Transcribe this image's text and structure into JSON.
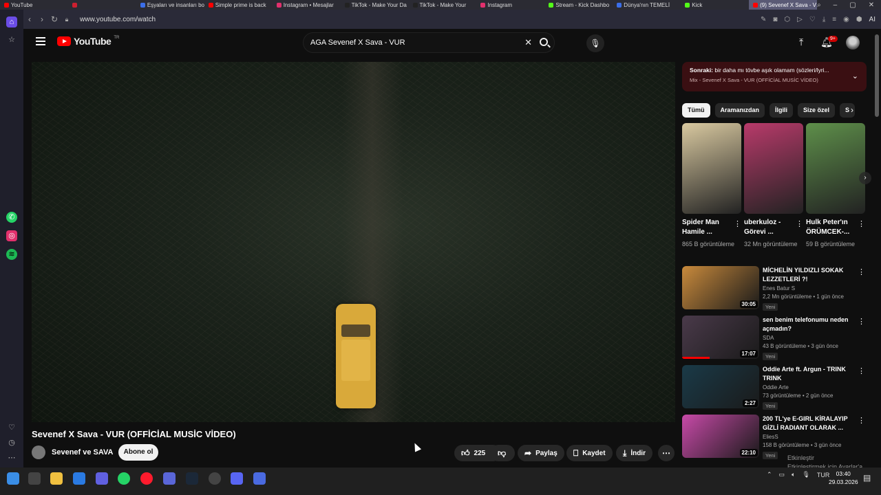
{
  "browser": {
    "tabs": [
      {
        "label": "YouTube",
        "color": "#ff0000"
      },
      {
        "label": "",
        "color": "#cc1f2f"
      },
      {
        "label": "Eşyaları ve insanları bo",
        "color": "#3b6ee8"
      },
      {
        "label": "Simple prime is back",
        "color": "#ff0000"
      },
      {
        "label": "Instagram • Mesajlar",
        "color": "#e1306c"
      },
      {
        "label": "TikTok - Make Your Da",
        "color": "#222222"
      },
      {
        "label": "TikTok - Make Your",
        "color": "#222222"
      },
      {
        "label": "Instagram",
        "color": "#e1306c"
      },
      {
        "label": "Stream - Kick Dashbo",
        "color": "#53fc18"
      },
      {
        "label": "Dünya'nın TEMELİ",
        "color": "#3b6ee8"
      },
      {
        "label": "Kick",
        "color": "#53fc18"
      },
      {
        "label": "(9) Sevenef X Sava - V",
        "color": "#ff0000"
      }
    ],
    "url": "www.youtube.com/watch",
    "ai_label": "AI"
  },
  "header": {
    "logo_text": "YouTube",
    "region": "TR",
    "search_value": "AGA Sevenef X Sava - VUR",
    "notif_badge": "9+"
  },
  "video": {
    "title": "Sevenef X Sava - VUR (OFFİCİAL MUSİC VİDEO)",
    "channel": "Sevenef ve SAVA",
    "subscribe_label": "Abone ol",
    "likes": "225",
    "share_label": "Paylaş",
    "save_label": "Kaydet",
    "download_label": "İndir"
  },
  "upnext": {
    "prefix": "Sonraki:",
    "title": " bir daha mı tövbe aşık olamam (sözleri/lyri...",
    "mix": "Mix - Sevenef X Sava - VUR (OFFİCİAL MUSİC VİDEO)"
  },
  "chips": [
    "Tümü",
    "Aramanızdan",
    "İlgili",
    "Size özel",
    "S"
  ],
  "shorts": [
    {
      "title": "Spider Man Hamile ...",
      "views": "865 B görüntüleme",
      "color": "#d9c9a0"
    },
    {
      "title": "uberkuloz - Görevi ...",
      "views": "32 Mn görüntüleme",
      "color": "#b83a6a"
    },
    {
      "title": "Hulk Peter'ın ÖRÜMCEK-...",
      "views": "59 B görüntüleme",
      "color": "#5e8f4a"
    }
  ],
  "videos": [
    {
      "title": "MİCHELİN YILDIZLI SOKAK LEZZETLERİ ?!",
      "channel": "Enes Batur S",
      "stats": "2,2 Mn görüntüleme • 1 gün önce",
      "duration": "30:05",
      "badge": "Yeni",
      "color": "#c98a3c"
    },
    {
      "title": "sen benim telefonumu neden açmadın?",
      "channel": "SDA",
      "stats": "43 B görüntüleme • 3 gün önce",
      "duration": "17:07",
      "badge": "Yeni",
      "color": "#4a3a4a"
    },
    {
      "title": "Oddie Arte ft. Argun - TRINK TRINK",
      "channel": "Oddie Arte",
      "stats": "73 görüntüleme • 2 gün önce",
      "duration": "2:27",
      "badge": "Yeni",
      "color": "#1a3a48"
    },
    {
      "title": "200 TL'ye E-GIRL KİRALAYIP GİZLİ RADIANT OLARAK ...",
      "channel": "EliesS",
      "stats": "158 B görüntüleme • 3 gün önce",
      "duration": "22:10",
      "badge": "Yeni",
      "color": "#c84aa8"
    }
  ],
  "windows_watermark": {
    "line1": "Etkinleştir",
    "line2": "Etkinleştirmek için Ayarlar'a gidin."
  },
  "taskbar": {
    "lang": "TUR",
    "time": "03:40",
    "date": "29.03.2026"
  }
}
